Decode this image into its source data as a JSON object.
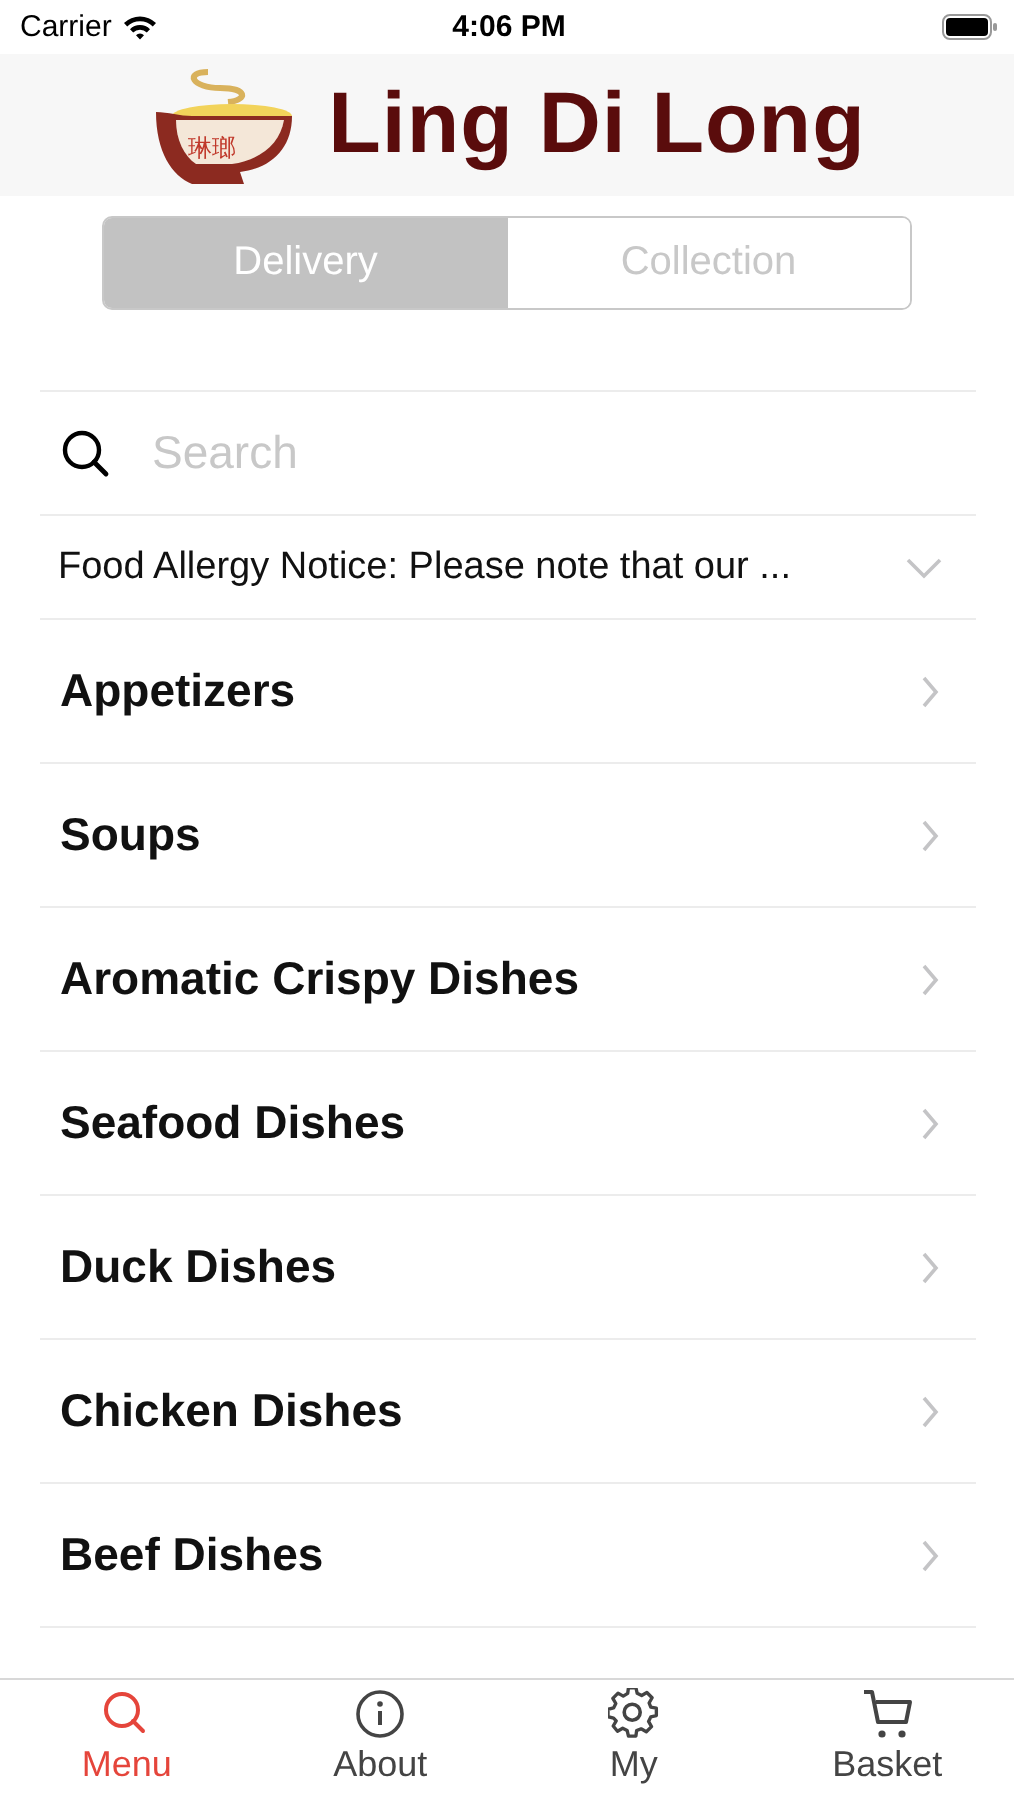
{
  "status_bar": {
    "carrier": "Carrier",
    "time": "4:06 PM"
  },
  "header": {
    "logo_mark": "琳瑯",
    "title": "Ling Di Long"
  },
  "order_type": [
    {
      "label": "Delivery",
      "selected": true
    },
    {
      "label": "Collection",
      "selected": false
    }
  ],
  "search": {
    "placeholder": "Search"
  },
  "notice": {
    "text": "Food Allergy Notice: Please note that our ...",
    "expanded": false
  },
  "categories": [
    "Appetizers",
    "Soups",
    "Aromatic Crispy Dishes",
    "Seafood Dishes",
    "Duck Dishes",
    "Chicken Dishes",
    "Beef Dishes"
  ],
  "tab_bar": [
    {
      "label": "Menu",
      "kind": "search",
      "selected": true
    },
    {
      "label": "About",
      "kind": "info",
      "selected": false
    },
    {
      "label": "My",
      "kind": "settings",
      "selected": false
    },
    {
      "label": "Basket",
      "kind": "basket",
      "selected": false
    }
  ]
}
